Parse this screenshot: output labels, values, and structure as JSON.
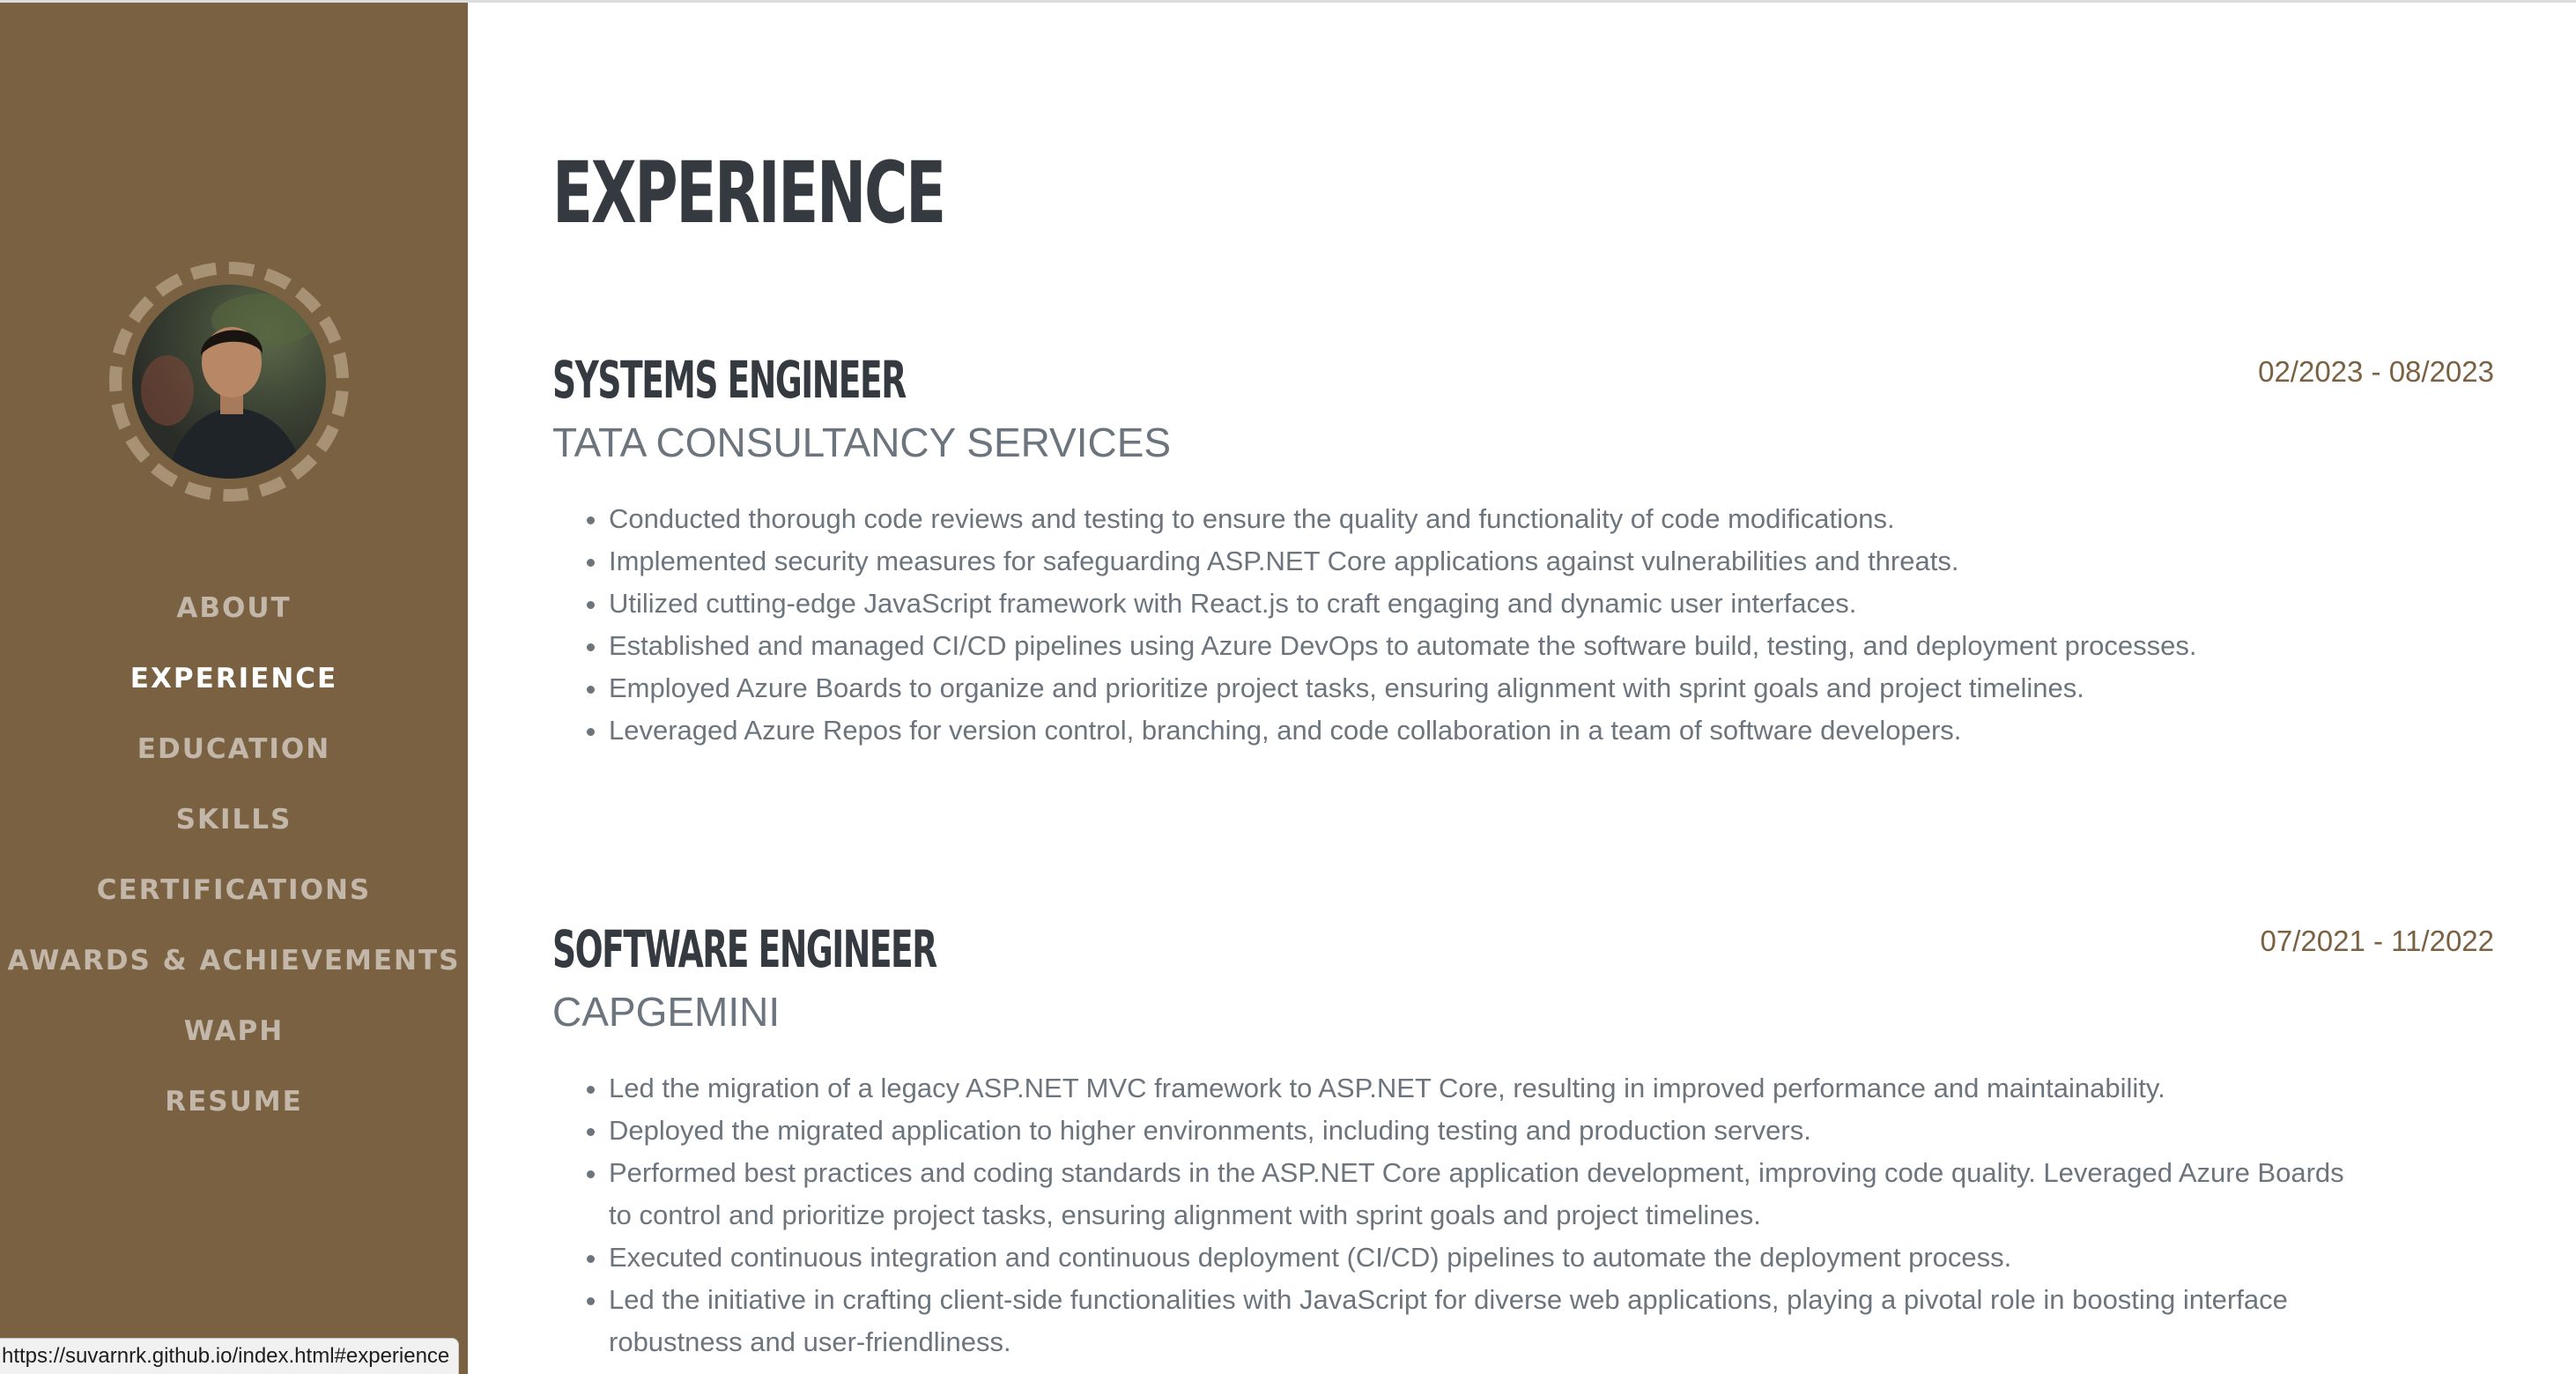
{
  "sidebar": {
    "avatar_alt": "profile photo",
    "nav": [
      {
        "label": "ABOUT",
        "active": false
      },
      {
        "label": "EXPERIENCE",
        "active": true
      },
      {
        "label": "EDUCATION",
        "active": false
      },
      {
        "label": "SKILLS",
        "active": false
      },
      {
        "label": "CERTIFICATIONS",
        "active": false
      },
      {
        "label": "AWARDS & ACHIEVEMENTS",
        "active": false
      },
      {
        "label": "WAPH",
        "active": false
      },
      {
        "label": "RESUME",
        "active": false
      }
    ]
  },
  "main": {
    "section_title": "EXPERIENCE",
    "jobs": [
      {
        "title": "SYSTEMS ENGINEER",
        "company": "TATA CONSULTANCY SERVICES",
        "date": "02/2023 - 08/2023",
        "points": [
          "Conducted thorough code reviews and testing to ensure the quality and functionality of code modifications.",
          "Implemented security measures for safeguarding ASP.NET Core applications against vulnerabilities and threats.",
          "Utilized cutting-edge JavaScript framework with React.js to craft engaging and dynamic user interfaces.",
          "Established and managed CI/CD pipelines using Azure DevOps to automate the software build, testing, and deployment processes.",
          "Employed Azure Boards to organize and prioritize project tasks, ensuring alignment with sprint goals and project timelines.",
          "Leveraged Azure Repos for version control, branching, and code collaboration in a team of software developers."
        ]
      },
      {
        "title": "SOFTWARE ENGINEER",
        "company": "CAPGEMINI",
        "date": "07/2021 - 11/2022",
        "points": [
          "Led the migration of a legacy ASP.NET MVC framework to ASP.NET Core, resulting in improved performance and maintainability.",
          "Deployed the migrated application to higher environments, including testing and production servers.",
          "Performed best practices and coding standards in the ASP.NET Core application development, improving code quality. Leveraged Azure Boards to control and prioritize project tasks, ensuring alignment with sprint goals and project timelines.",
          "Executed continuous integration and continuous deployment (CI/CD) pipelines to automate the deployment process.",
          "Led the initiative in crafting client-side functionalities with JavaScript for diverse web applications, playing a pivotal role in boosting interface robustness and user-friendliness."
        ]
      }
    ]
  },
  "status_bar": {
    "url": "https://suvarnrk.github.io/index.html#experience"
  },
  "colors": {
    "sidebar_bg": "#7a6142",
    "heading": "#343a40",
    "body_text": "#6c757d",
    "date": "#7a6142"
  }
}
